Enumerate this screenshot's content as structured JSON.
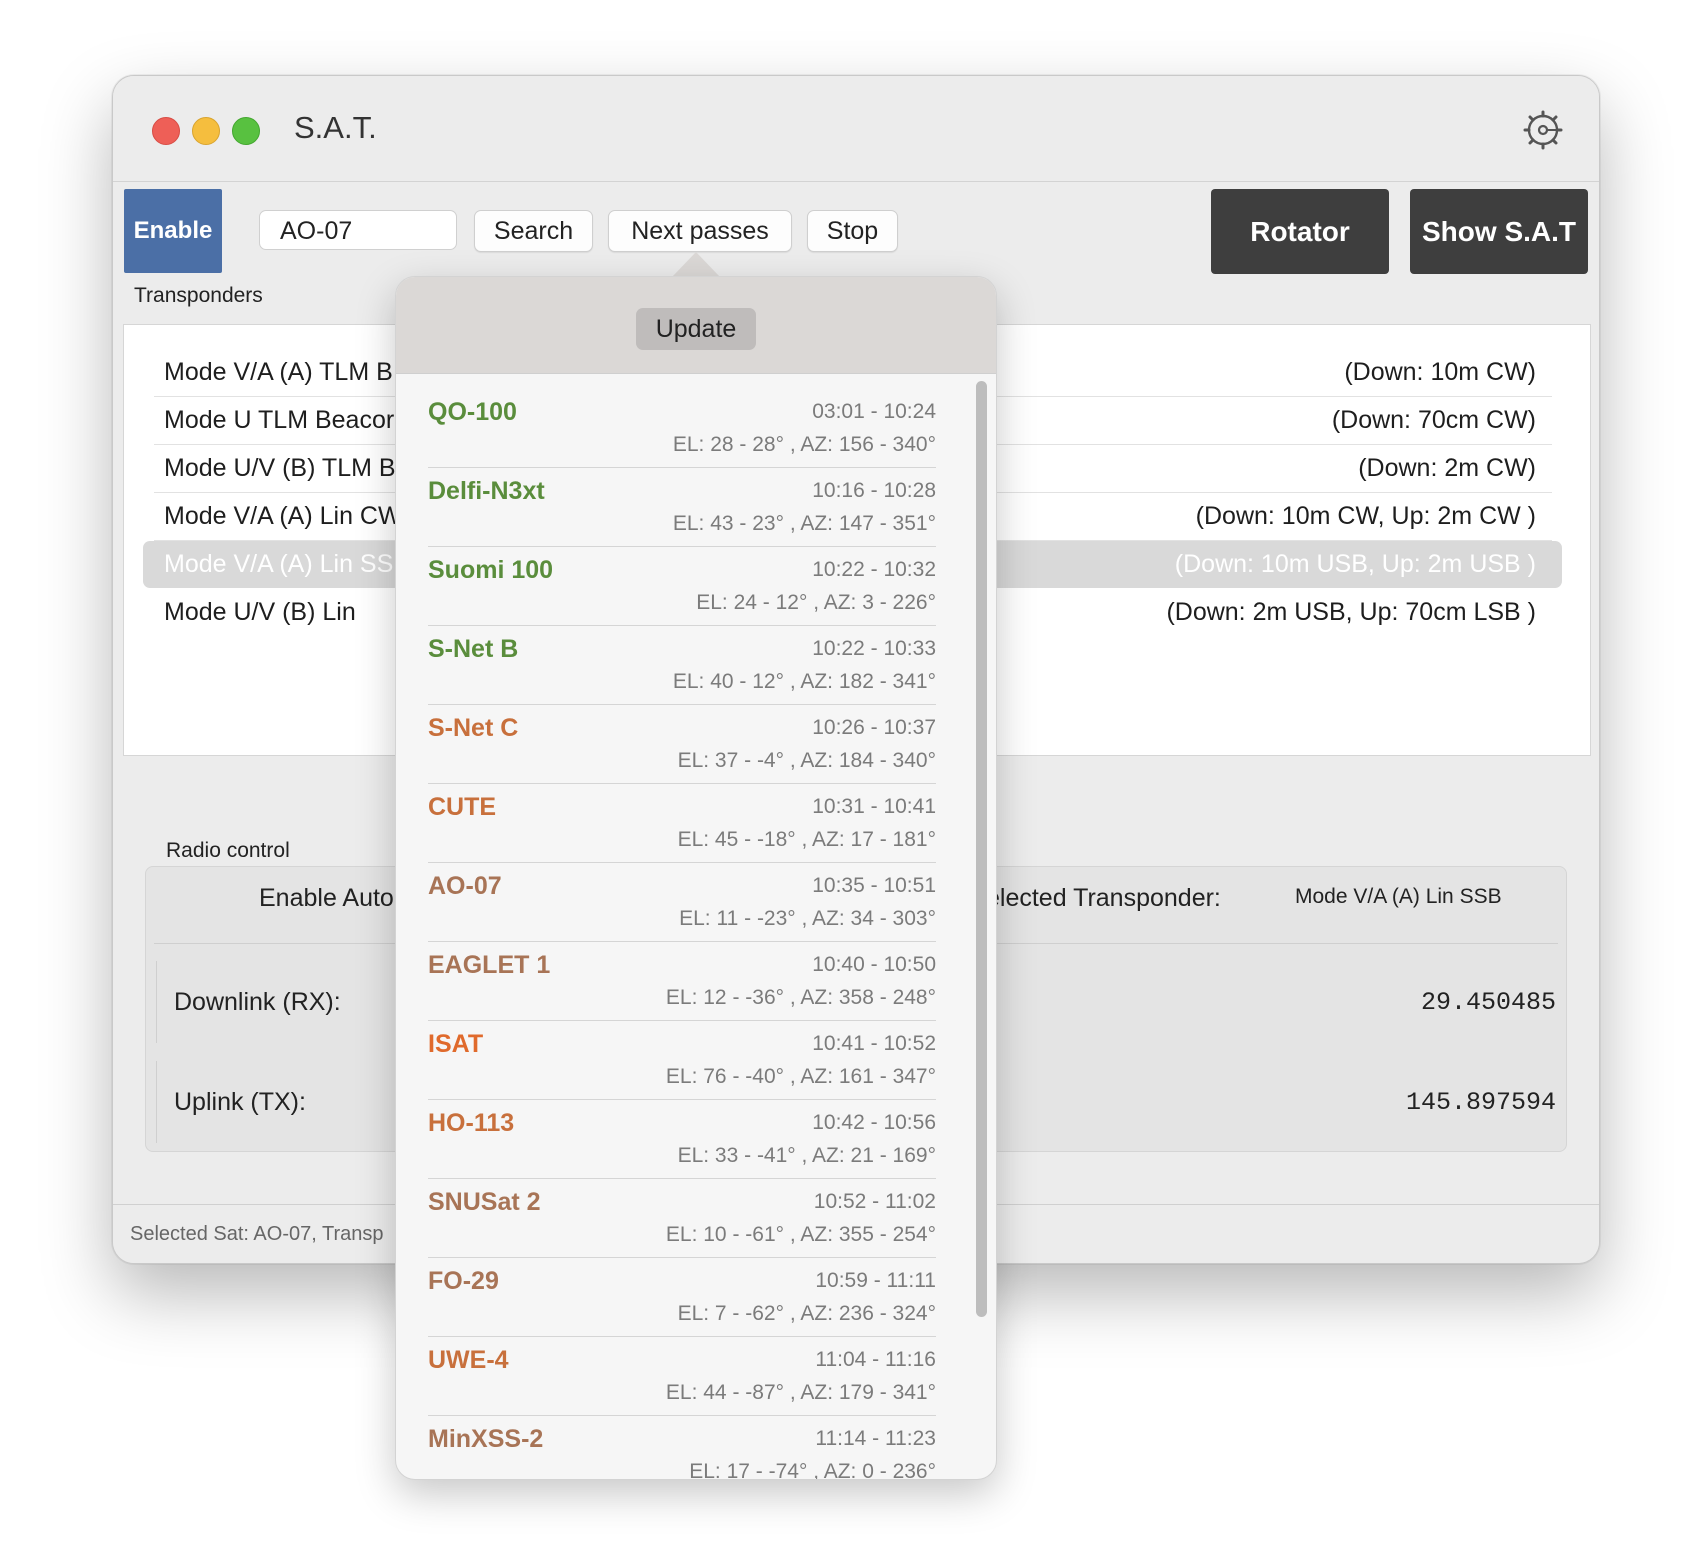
{
  "window": {
    "title": "S.A.T."
  },
  "toolbar": {
    "enable_label": "Enable",
    "sat_input_value": "AO-07",
    "search_label": "Search",
    "next_passes_label": "Next passes",
    "stop_label": "Stop",
    "rotator_label": "Rotator",
    "show_sat_label": "Show S.A.T"
  },
  "transponders": {
    "title": "Transponders",
    "rows": [
      {
        "name": "Mode V/A (A) TLM B",
        "detail": "(Down: 10m CW)"
      },
      {
        "name": "Mode U TLM Beacor",
        "detail": "(Down: 70cm CW)"
      },
      {
        "name": "Mode U/V (B) TLM B",
        "detail": "(Down: 2m CW)"
      },
      {
        "name": "Mode V/A (A) Lin CW",
        "detail": "(Down: 10m CW, Up: 2m CW )"
      },
      {
        "name": "Mode V/A (A) Lin SS",
        "detail": "(Down: 10m USB, Up: 2m USB )",
        "selected": true
      },
      {
        "name": "Mode U/V (B) Lin",
        "detail": "(Down: 2m USB, Up: 70cm LSB )"
      }
    ]
  },
  "radio": {
    "title": "Radio control",
    "enable_auto_label": "Enable Auto",
    "selected_transponder_label": "elected Transponder:",
    "selected_transponder_value": "Mode V/A (A) Lin SSB",
    "downlink_label": "Downlink (RX):",
    "downlink_value": "29.450485",
    "uplink_label": "Uplink (TX):",
    "uplink_value": "145.897594"
  },
  "status": {
    "text": "Selected Sat: AO-07, Transp"
  },
  "popover": {
    "update_label": "Update",
    "passes": [
      {
        "name": "QO-100",
        "time": "03:01 - 10:24",
        "elaz": "EL: 28 - 28° , AZ: 156 - 340°",
        "color": "#5a8d3c"
      },
      {
        "name": "Delfi-N3xt",
        "time": "10:16 - 10:28",
        "elaz": "EL: 43 - 23° , AZ: 147 - 351°",
        "color": "#5a8d3c"
      },
      {
        "name": "Suomi 100",
        "time": "10:22 - 10:32",
        "elaz": "EL: 24 - 12° , AZ: 3 - 226°",
        "color": "#5a8d3c"
      },
      {
        "name": "S-Net B",
        "time": "10:22 - 10:33",
        "elaz": "EL: 40 - 12° , AZ: 182 - 341°",
        "color": "#5a8d3c"
      },
      {
        "name": "S-Net C",
        "time": "10:26 - 10:37",
        "elaz": "EL: 37 - -4° , AZ: 184 - 340°",
        "color": "#c8703c"
      },
      {
        "name": "CUTE",
        "time": "10:31 - 10:41",
        "elaz": "EL: 45 - -18° , AZ: 17 - 181°",
        "color": "#c8703c"
      },
      {
        "name": "AO-07",
        "time": "10:35 - 10:51",
        "elaz": "EL: 11 - -23° , AZ: 34 - 303°",
        "color": "#a87456"
      },
      {
        "name": "EAGLET 1",
        "time": "10:40 - 10:50",
        "elaz": "EL: 12 - -36° , AZ: 358 - 248°",
        "color": "#a87456"
      },
      {
        "name": "ISAT",
        "time": "10:41 - 10:52",
        "elaz": "EL: 76 - -40° , AZ: 161 - 347°",
        "color": "#e06a2c"
      },
      {
        "name": "HO-113",
        "time": "10:42 - 10:56",
        "elaz": "EL: 33 - -41° , AZ: 21 - 169°",
        "color": "#c8703c"
      },
      {
        "name": "SNUSat 2",
        "time": "10:52 - 11:02",
        "elaz": "EL: 10 - -61° , AZ: 355 - 254°",
        "color": "#a87456"
      },
      {
        "name": "FO-29",
        "time": "10:59 - 11:11",
        "elaz": "EL: 7 - -62° , AZ: 236 - 324°",
        "color": "#a87456"
      },
      {
        "name": "UWE-4",
        "time": "11:04 - 11:16",
        "elaz": "EL: 44 - -87° , AZ: 179 - 341°",
        "color": "#c8703c"
      },
      {
        "name": "MinXSS-2",
        "time": "11:14 - 11:23",
        "elaz": "EL: 17 - -74° , AZ: 0 - 236°",
        "color": "#a87456"
      }
    ]
  },
  "icons": {
    "close": "close-icon",
    "minimize": "minimize-icon",
    "zoom": "zoom-icon",
    "settings": "gear-icon"
  }
}
